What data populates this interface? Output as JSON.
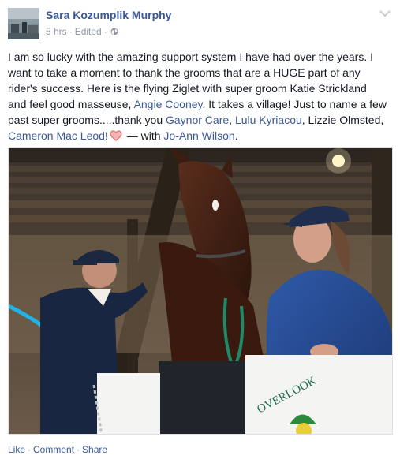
{
  "post": {
    "author": "Sara Kozumplik Murphy",
    "time": "5 hrs",
    "separator": "·",
    "edited": "Edited",
    "text": {
      "p1": "I am so lucky with the amazing support system I have had over the years. I want to take a moment to thank the grooms that are a HUGE part of any rider's success. Here is the flying Ziglet with super groom Katie Strickland and feel good masseuse, ",
      "mention1": "Angie Cooney",
      "p2": ". It takes a village! Just to name a few past super grooms.....thank you ",
      "mention2": "Gaynor Care",
      "comma1": ", ",
      "mention3": "Lulu Kyriacou",
      "p3": ", Lizzie Olmsted, ",
      "mention4": "Cameron Mac Leod",
      "p4": "!",
      "with_text": " — with ",
      "mention5": "Jo-Ann Wilson",
      "p5": "."
    },
    "photo_sign_text": "OVERLOOK",
    "actions": {
      "like": "Like",
      "comment": "Comment",
      "share": "Share",
      "dot": "·"
    }
  },
  "colors": {
    "link": "#3b5998",
    "meta": "#9197a3",
    "text": "#141823",
    "heart": "#e9716e"
  },
  "icons": [
    "globe-icon",
    "chevron-down-icon",
    "heart-icon"
  ]
}
